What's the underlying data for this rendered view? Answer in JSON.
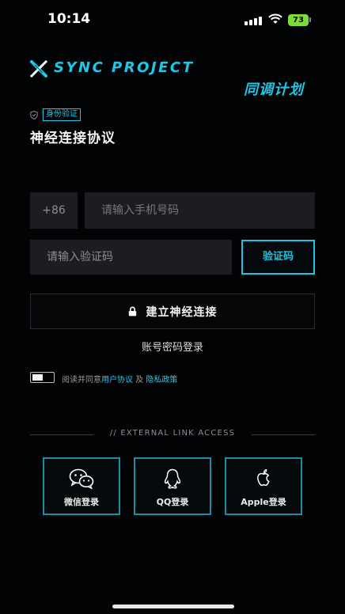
{
  "status_bar": {
    "time": "10:14",
    "battery": "73"
  },
  "brand": {
    "name": "SYNC PROJECT",
    "name_cn": "同调计划"
  },
  "auth": {
    "badge": "身份验证",
    "title": "神经连接协议"
  },
  "form": {
    "country_code": "+86",
    "phone_placeholder": "请输入手机号码",
    "code_placeholder": "请输入验证码",
    "get_code_label": "验证码",
    "connect_label": "建立神经连接",
    "password_login_label": "账号密码登录"
  },
  "agreement": {
    "prefix": "阅读并同意",
    "user_agreement": "用户协议",
    "and": " 及 ",
    "privacy_policy": "隐私政策"
  },
  "external": {
    "label": "// EXTERNAL LINK ACCESS",
    "providers": [
      {
        "label": "微信登录",
        "icon": "wechat-icon"
      },
      {
        "label": "QQ登录",
        "icon": "qq-icon"
      },
      {
        "label": "Apple登录",
        "icon": "apple-icon"
      }
    ]
  },
  "colors": {
    "accent": "#20c6e6",
    "background": "#020305",
    "field": "#1c1d20"
  }
}
